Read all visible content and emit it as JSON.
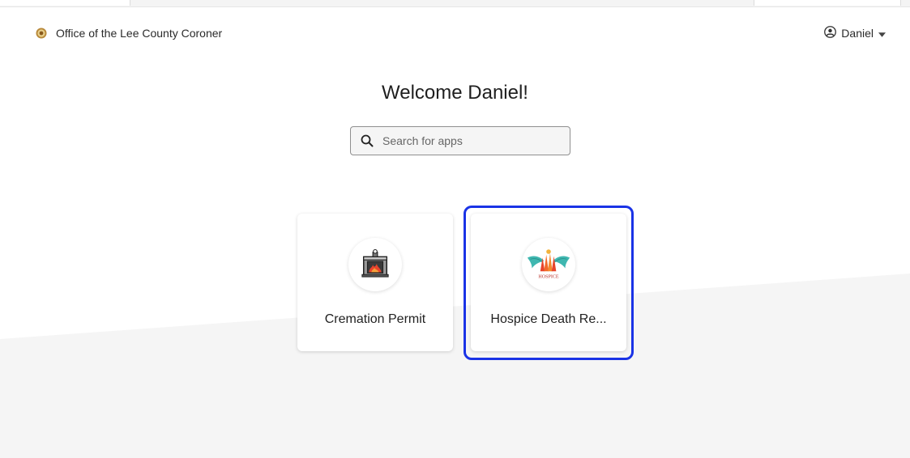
{
  "header": {
    "org_name": "Office of the Lee County Coroner",
    "org_logo_icon": "county-seal-icon",
    "user_name": "Daniel",
    "user_icon": "user-circle-icon",
    "menu_icon": "caret-down-icon"
  },
  "welcome": {
    "title": "Welcome Daniel!"
  },
  "search": {
    "placeholder": "Search for apps",
    "value": "",
    "icon": "search-icon"
  },
  "apps": [
    {
      "label": "Cremation Permit",
      "icon": "cremation-furnace-icon"
    },
    {
      "label": "Hospice Death Re...",
      "icon": "hospice-logo-icon",
      "logo_text": "HOSPICE",
      "highlighted": true
    }
  ],
  "colors": {
    "highlight": "#1a33e6",
    "background_band": "#f5f5f5"
  }
}
